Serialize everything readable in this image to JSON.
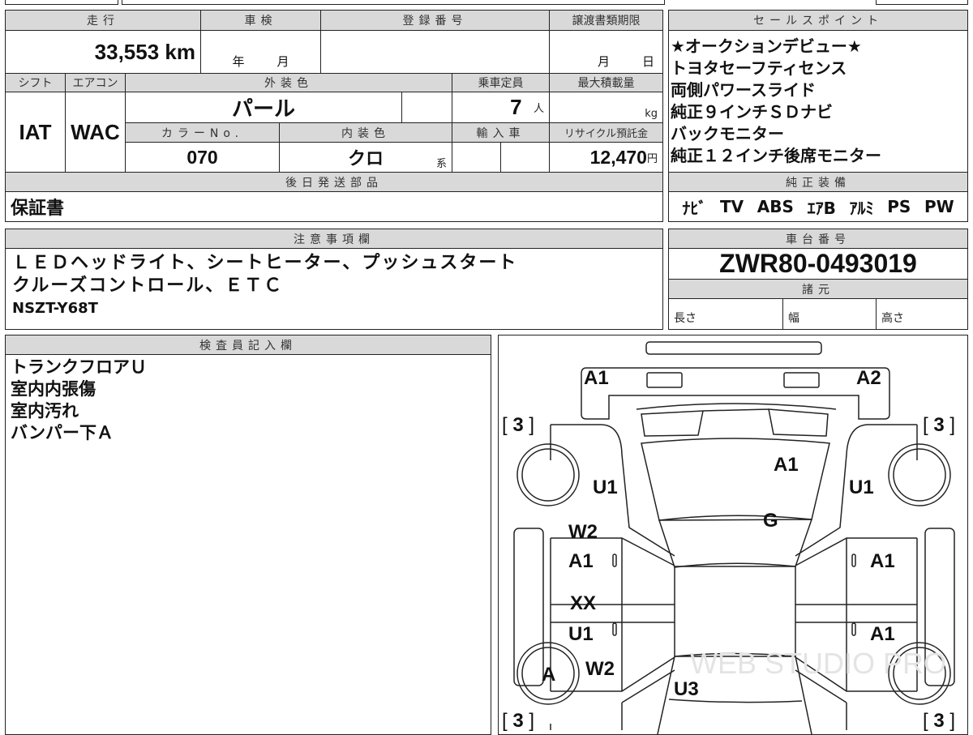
{
  "vehicle": {
    "mileage_label": "走行",
    "mileage": "33,553",
    "mileage_unit": "km",
    "inspection_label": "車検",
    "inspection_year_unit": "年",
    "inspection_month_unit": "月",
    "registration_label": "登録番号",
    "registration": "",
    "transfer_deadline_label": "譲渡書類期限",
    "transfer_month_unit": "月",
    "transfer_day_unit": "日",
    "shift_label": "シフト",
    "shift": "IAT",
    "ac_label": "エアコン",
    "ac": "WAC",
    "exterior_color_label": "外装色",
    "exterior_color": "パール",
    "capacity_label": "乗車定員",
    "capacity": "7",
    "capacity_unit": "人",
    "max_load_label": "最大積載量",
    "max_load_unit": "kg",
    "color_no_label": "カラーNo.",
    "color_no": "070",
    "interior_color_label": "内装色",
    "interior_color": "クロ",
    "interior_color_suffix": "系",
    "import_label": "輸入車",
    "recycle_label": "リサイクル預託金",
    "recycle_fee": "12,470",
    "recycle_unit": "円",
    "later_parts_label": "後日発送部品",
    "later_parts": "保証書"
  },
  "sales_points": {
    "label": "セールスポイント",
    "items": [
      "★オークションデビュー★",
      "トヨタセーフティセンス",
      "両側パワースライド",
      "純正９インチＳＤナビ",
      "バックモニター",
      "純正１２インチ後席モニター"
    ]
  },
  "equipment": {
    "label": "純正装備",
    "items": [
      "ﾅﾋﾞ",
      "TV",
      "ABS",
      "ｴｱB",
      "ｱﾙﾐ",
      "PS",
      "PW"
    ]
  },
  "notes": {
    "label": "注意事項欄",
    "lines": [
      "ＬＥＤヘッドライト、シートヒーター、プッシュスタート",
      "クルーズコントロール、ＥＴＣ",
      "NSZT-Y68T"
    ]
  },
  "chassis": {
    "label": "車台番号",
    "number": "ZWR80-0493019",
    "specs_label": "諸元",
    "length_label": "長さ",
    "width_label": "幅",
    "height_label": "高さ"
  },
  "inspector": {
    "label": "検査員記入欄",
    "lines": [
      "トランクフロアＵ",
      "室内内張傷",
      "室内汚れ",
      "バンパー下Ａ"
    ]
  },
  "diagram": {
    "tire_tread": "3",
    "marks": {
      "rear_left": "A1",
      "rear_right": "A2",
      "roof": "A1",
      "windshield": "G",
      "left_rear_fender": "U1",
      "right_rear_fender": "U1",
      "left_rear_door_1": "W2",
      "left_rear_door_2": "A1",
      "left_front_door_1": "XX",
      "left_front_door_2": "U1",
      "right_rear_door": "A1",
      "right_front_door": "A1",
      "left_front_wheel": "A",
      "left_front_fender": "W2",
      "hood": "U3"
    },
    "door_mark": "0",
    "watermark": "WEB STUDIO PRO"
  }
}
